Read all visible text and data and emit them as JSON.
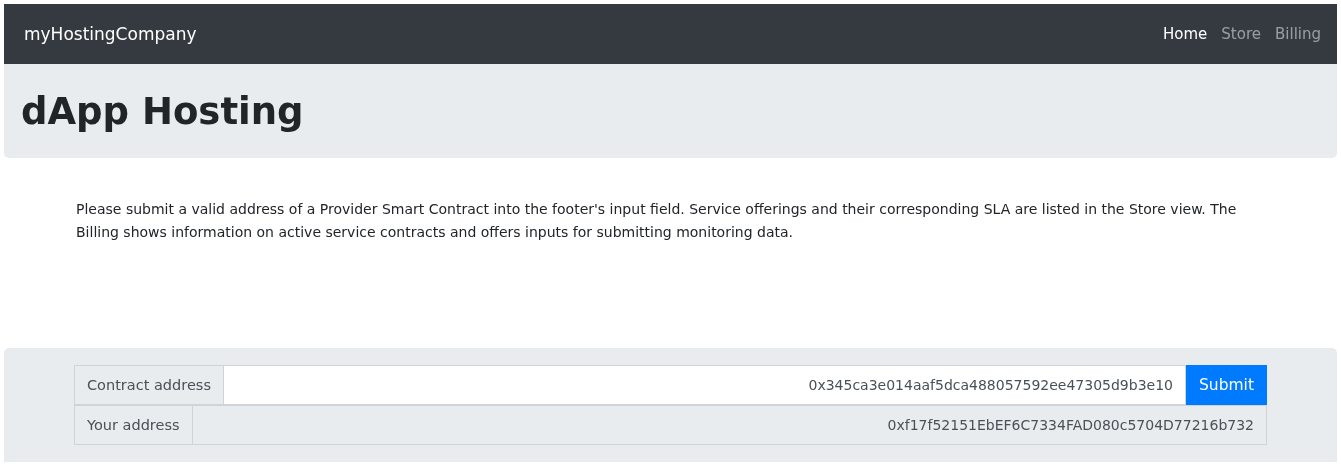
{
  "navbar": {
    "brand": "myHostingCompany",
    "links": [
      {
        "label": "Home",
        "selected": true
      },
      {
        "label": "Store",
        "selected": false
      },
      {
        "label": "Billing",
        "selected": false
      }
    ]
  },
  "header": {
    "title": "dApp Hosting"
  },
  "intro": "Please submit a valid address of a Provider Smart Contract into the footer's input field. Service offerings and their corresponding SLA are listed in the Store view. The Billing shows information on active service contracts and offers inputs for submitting monitoring data.",
  "footer": {
    "contract": {
      "label": "Contract address",
      "value": "0x345ca3e014aaf5dca488057592ee47305d9b3e10",
      "button": "Submit"
    },
    "account": {
      "label": "Your address",
      "value": "0xf17f52151EbEF6C7334FAD080c5704D77216b732"
    }
  }
}
